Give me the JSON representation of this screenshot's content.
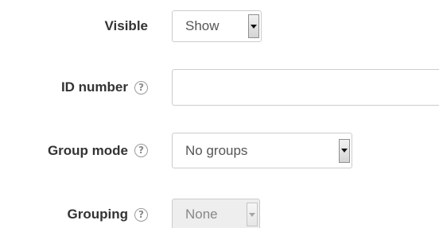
{
  "form": {
    "visible": {
      "label": "Visible",
      "value": "Show"
    },
    "id_number": {
      "label": "ID number",
      "help_icon": "question-mark-circle-icon",
      "value": ""
    },
    "group_mode": {
      "label": "Group mode",
      "help_icon": "question-mark-circle-icon",
      "value": "No groups"
    },
    "grouping": {
      "label": "Grouping",
      "help_icon": "question-mark-circle-icon",
      "value": "None",
      "disabled": true
    },
    "help_glyph": "?"
  }
}
